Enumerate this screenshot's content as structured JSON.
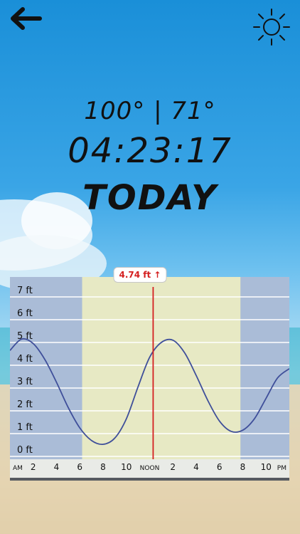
{
  "nav": {
    "back_icon": "arrow-left-icon",
    "settings_icon": "sun-icon"
  },
  "header": {
    "temps": "100° | 71°",
    "time": "04:23:17",
    "day": "TODAY"
  },
  "tide_chart": {
    "callout": "4.74 ft ↑",
    "callout_color": "#d42020",
    "line_color": "#3f4f9a",
    "night_band_color": "#aabcd7",
    "day_band_color": "#e7e9c4",
    "y_labels": [
      "0 ft",
      "1 ft",
      "2 ft",
      "3 ft",
      "4 ft",
      "5 ft",
      "6 ft",
      "7 ft"
    ],
    "x_labels": [
      "AM",
      "2",
      "4",
      "6",
      "8",
      "10",
      "NOON",
      "2",
      "4",
      "6",
      "8",
      "10",
      "PM"
    ]
  },
  "chart_data": {
    "type": "line",
    "title": "",
    "xlabel": "",
    "ylabel": "",
    "ylim": [
      0,
      7
    ],
    "x_hours": [
      0,
      1,
      2,
      3,
      4,
      5,
      6,
      7,
      8,
      9,
      10,
      11,
      12,
      13,
      14,
      15,
      16,
      17,
      18,
      19,
      20,
      21,
      22,
      23,
      24
    ],
    "series": [
      {
        "values": [
          4.4,
          4.9,
          4.7,
          4.0,
          3.0,
          1.9,
          1.0,
          0.45,
          0.28,
          0.55,
          1.4,
          2.8,
          4.1,
          4.75,
          4.85,
          4.3,
          3.3,
          2.2,
          1.3,
          0.85,
          0.9,
          1.4,
          2.3,
          3.2,
          3.6
        ]
      }
    ],
    "current_hour": 12.3,
    "current_value": 4.74,
    "day_start_hour": 6.2,
    "day_end_hour": 19.8
  }
}
